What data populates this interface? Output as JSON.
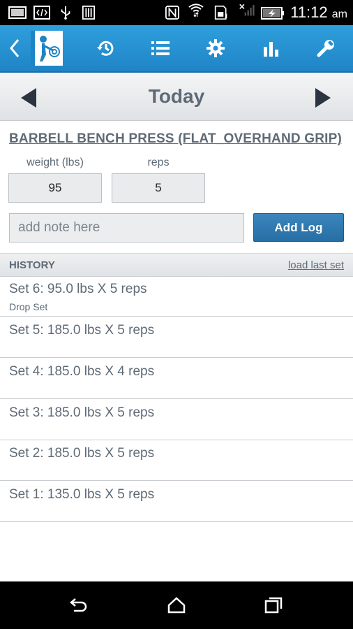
{
  "status_bar": {
    "time": "11:12",
    "ampm": "am",
    "icons": [
      "screenshot-icon",
      "code-icon",
      "usb-icon",
      "sim-icon",
      "nfc-icon",
      "wifi-icon",
      "sd-card-icon",
      "no-signal-icon",
      "battery-charging-icon"
    ]
  },
  "action_bar": {
    "icons": [
      "back-icon",
      "app-logo",
      "history-icon",
      "list-icon",
      "settings-icon",
      "chart-icon",
      "wrench-icon"
    ],
    "accent": "#1f84c6"
  },
  "date_nav": {
    "title": "Today"
  },
  "exercise": {
    "title": "BARBELL BENCH PRESS (FLAT_OVERHAND GRIP)"
  },
  "inputs": {
    "weight_label": "weight (lbs)",
    "weight_value": "95",
    "reps_label": "reps",
    "reps_value": "5",
    "note_placeholder": "add note here",
    "add_button": "Add Log"
  },
  "history": {
    "label": "HISTORY",
    "load_last": "load last set",
    "sets": [
      {
        "text": "Set 6: 95.0 lbs X 5 reps",
        "note": "Drop Set"
      },
      {
        "text": "Set 5: 185.0 lbs X 5 reps",
        "note": ""
      },
      {
        "text": "Set 4: 185.0 lbs X 4 reps",
        "note": ""
      },
      {
        "text": "Set 3: 185.0 lbs X 5 reps",
        "note": ""
      },
      {
        "text": "Set 2: 185.0 lbs X 5 reps",
        "note": ""
      },
      {
        "text": "Set 1: 135.0 lbs X 5 reps",
        "note": ""
      }
    ]
  },
  "nav_bar": {
    "icons": [
      "back-nav-icon",
      "home-nav-icon",
      "recents-nav-icon"
    ]
  }
}
